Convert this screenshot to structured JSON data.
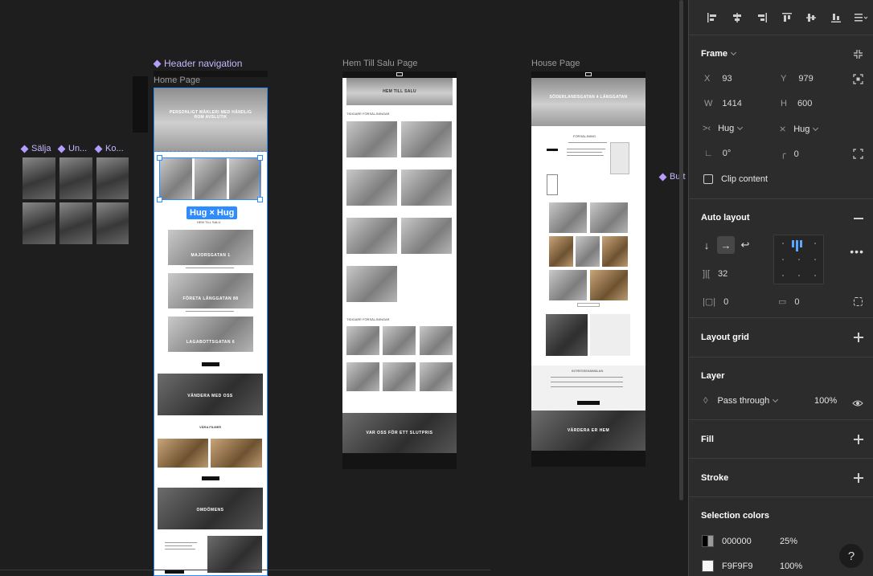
{
  "canvas": {
    "labels": {
      "header_navigation": "Header navigation",
      "home_page": "Home Page",
      "hem_till_salu": "Hem Till Salu Page",
      "house_page": "House Page",
      "salja": "Sälja",
      "un": "Un...",
      "ko": "Ko...",
      "butt": "Butt"
    },
    "hug_tag": "Hug × Hug",
    "home": {
      "hero_text": "PERSONLIGT MÄKLERI MED HÄNDLIG ROM AVSLUTIK",
      "sub_label": "HEM TILL SALU",
      "listing_1": "MAJORSGATAN 1",
      "listing_2": "FÖRETA LÅNGGATAN 88",
      "listing_3": "LAGABOTTSGATAN 6",
      "band_text": "VÄNDERA MED OSS",
      "films_title": "VÅRA FILMER",
      "band2_text": "OMDÖMENS"
    },
    "salu": {
      "hero_text": "HEM TILL SALU",
      "label_1": "TIDIGARE FÖRSÄLJNINGAR",
      "label_2": "TIDIGARE FÖRSÄLJNINGAR",
      "footer_text": "VAR OSS FÖR ETT SLUTPRIS"
    },
    "house": {
      "hero_text": "SÖDERLANDSGATAN 4 LÄNGGATAN",
      "title": "FÖRSÄLJNING",
      "form_title": "INTRESSEANMÄLAN",
      "footer_text": "VÄRDERA ER HEM"
    }
  },
  "panel": {
    "frame": {
      "title": "Frame",
      "x_label": "X",
      "x": "93",
      "y_label": "Y",
      "y": "979",
      "w_label": "W",
      "w": "1414",
      "h_label": "H",
      "h": "600",
      "hug_w": "Hug",
      "hug_h": "Hug",
      "rotation": "0°",
      "radius": "0",
      "clip": "Clip content"
    },
    "auto_layout": {
      "title": "Auto layout",
      "gap": "32",
      "pad_h": "0",
      "pad_v": "0"
    },
    "layout_grid": {
      "title": "Layout grid"
    },
    "layer": {
      "title": "Layer",
      "mode": "Pass through",
      "opacity": "100%"
    },
    "fill": {
      "title": "Fill"
    },
    "stroke": {
      "title": "Stroke"
    },
    "selection_colors": {
      "title": "Selection colors",
      "colors": [
        {
          "hex": "000000",
          "opacity": "25%",
          "swatch": "#000000"
        },
        {
          "hex": "F9F9F9",
          "opacity": "100%",
          "swatch": "#F9F9F9"
        }
      ]
    },
    "help": "?"
  }
}
